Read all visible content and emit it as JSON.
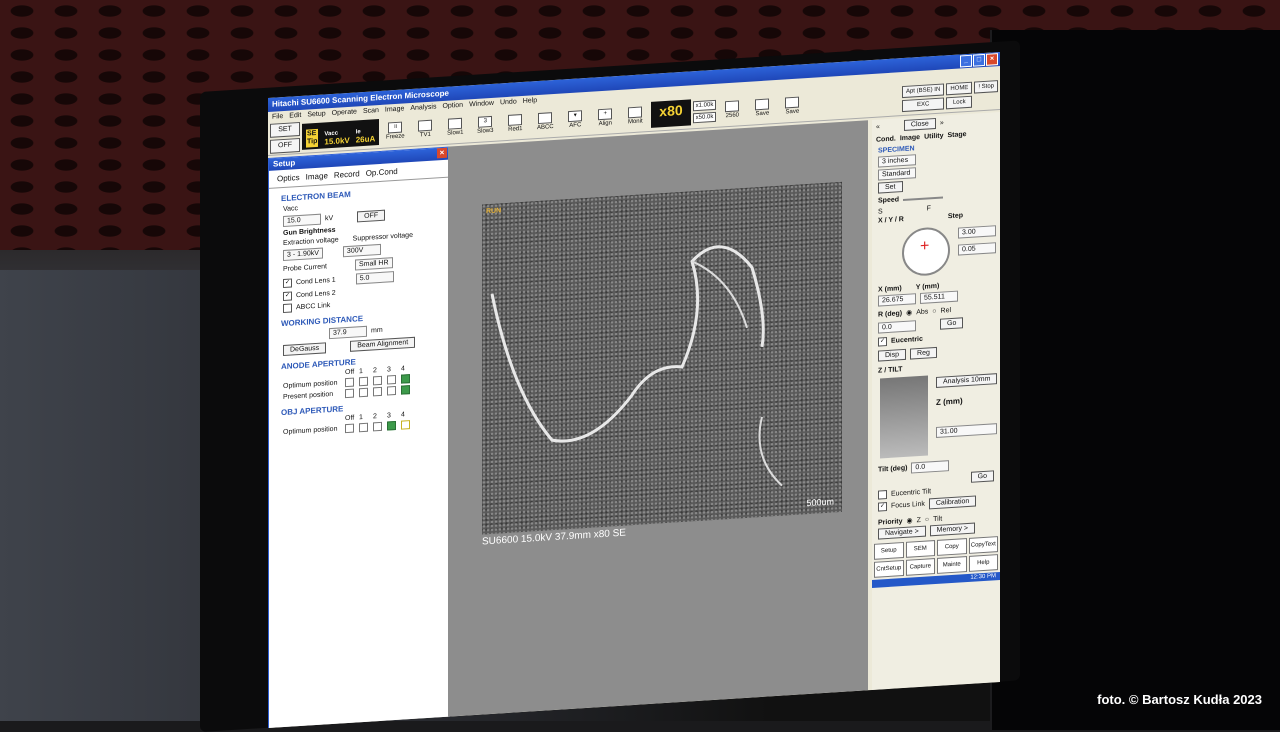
{
  "window": {
    "title": "Hitachi SU6600 Scanning Electron Microscope",
    "controls": [
      "_",
      "□",
      "×"
    ]
  },
  "menu": [
    "File",
    "Edit",
    "Setup",
    "Operate",
    "Scan",
    "Image",
    "Analysis",
    "Option",
    "Window",
    "Undo",
    "Help"
  ],
  "toolbar": {
    "set": "SET",
    "off": "OFF",
    "se": "SE",
    "tip": "Tip",
    "vacc_label": "Vacc",
    "vacc_value": "15.0kV",
    "ie_label": "Ie",
    "ie_value": "26uA",
    "buttons": [
      "Freeze",
      "TV1",
      "Slow1",
      "Slow3",
      "Red1",
      "ABCC",
      "AFC",
      "Align",
      "Monit"
    ],
    "mag": "x80",
    "mag_small_1": "x1.00k",
    "mag_small_2": "x50.0k",
    "extra": [
      "2560",
      "Save",
      "Save"
    ],
    "right_buttons": [
      "Apt (BSE) IN",
      "HOME",
      "! Stop",
      "EXC",
      "Lock"
    ]
  },
  "setup": {
    "title": "Setup",
    "tabs": [
      "Optics",
      "Image",
      "Record",
      "Op.Cond"
    ],
    "electron_beam": "ELECTRON BEAM",
    "vacc": "Vacc",
    "vacc_value": "15.0",
    "kv": "kV",
    "off": "OFF",
    "gun_brightness": "Gun Brightness",
    "extraction_voltage": "Extraction voltage",
    "extraction_value": "3 - 1.90kV",
    "suppressor_voltage": "Suppressor voltage",
    "suppressor_value": "300V",
    "probe_current": "Probe Current",
    "probe_mode": "Small HR",
    "probe_value": "5.0",
    "cond_lens_1": "Cond Lens 1",
    "cond_lens_2": "Cond Lens 2",
    "abcc_link": "ABCC Link",
    "working_distance": "WORKING DISTANCE",
    "wd_value": "37.9",
    "mm": "mm",
    "degauss": "DeGauss",
    "beam_alignment": "Beam Alignment",
    "anode_aperture": "ANODE APERTURE",
    "aperture_cols": [
      "Off",
      "1",
      "2",
      "3",
      "4"
    ],
    "optimum_position": "Optimum position",
    "present_position": "Present position",
    "obj_aperture": "OBJ APERTURE"
  },
  "image": {
    "run": "RUN",
    "scale_bar": "500um",
    "caption": "SU6600 15.0kV 37.9mm x80 SE"
  },
  "right_panel": {
    "close": "Close",
    "tabs": [
      "Cond.",
      "Image",
      "Utility",
      "Stage"
    ],
    "specimen": "SPECIMEN",
    "size": "3 inches",
    "holder": "Standard",
    "set": "Set",
    "speed": "Speed",
    "speed_s": "S",
    "speed_f": "F",
    "xyr": "X / Y / R",
    "step": "Step",
    "step_x": "3.00",
    "step_y": "0.05",
    "x_label": "X (mm)",
    "y_label": "Y (mm)",
    "x_value": "26.675",
    "y_value": "55.511",
    "r_label": "R (deg)",
    "abs": "Abs",
    "rel": "Rel",
    "r_value": "0.0",
    "go": "Go",
    "eucentric": "Eucentric",
    "disp": "Disp",
    "reg": "Reg",
    "ztilt": "Z / TILT",
    "analysis": "Analysis 10mm",
    "z_label": "Z (mm)",
    "z_value": "31.00",
    "tilt_label": "Tilt (deg)",
    "tilt_value": "0.0",
    "go2": "Go",
    "eucentric_tilt": "Eucentric Tilt",
    "focus_link": "Focus Link",
    "calibration": "Calibration",
    "priority": "Priority",
    "priority_z": "Z",
    "priority_tilt": "Tilt",
    "navigate": "Navigate >",
    "memory": "Memory >",
    "bottom": [
      "Setup",
      "SEM",
      "Copy",
      "CopyText",
      "CntSetup",
      "Capture",
      "Mainte",
      "Help"
    ]
  },
  "taskbar": {
    "time": "12:30 PM"
  },
  "watermark": "foto. © Bartosz Kudła 2023"
}
